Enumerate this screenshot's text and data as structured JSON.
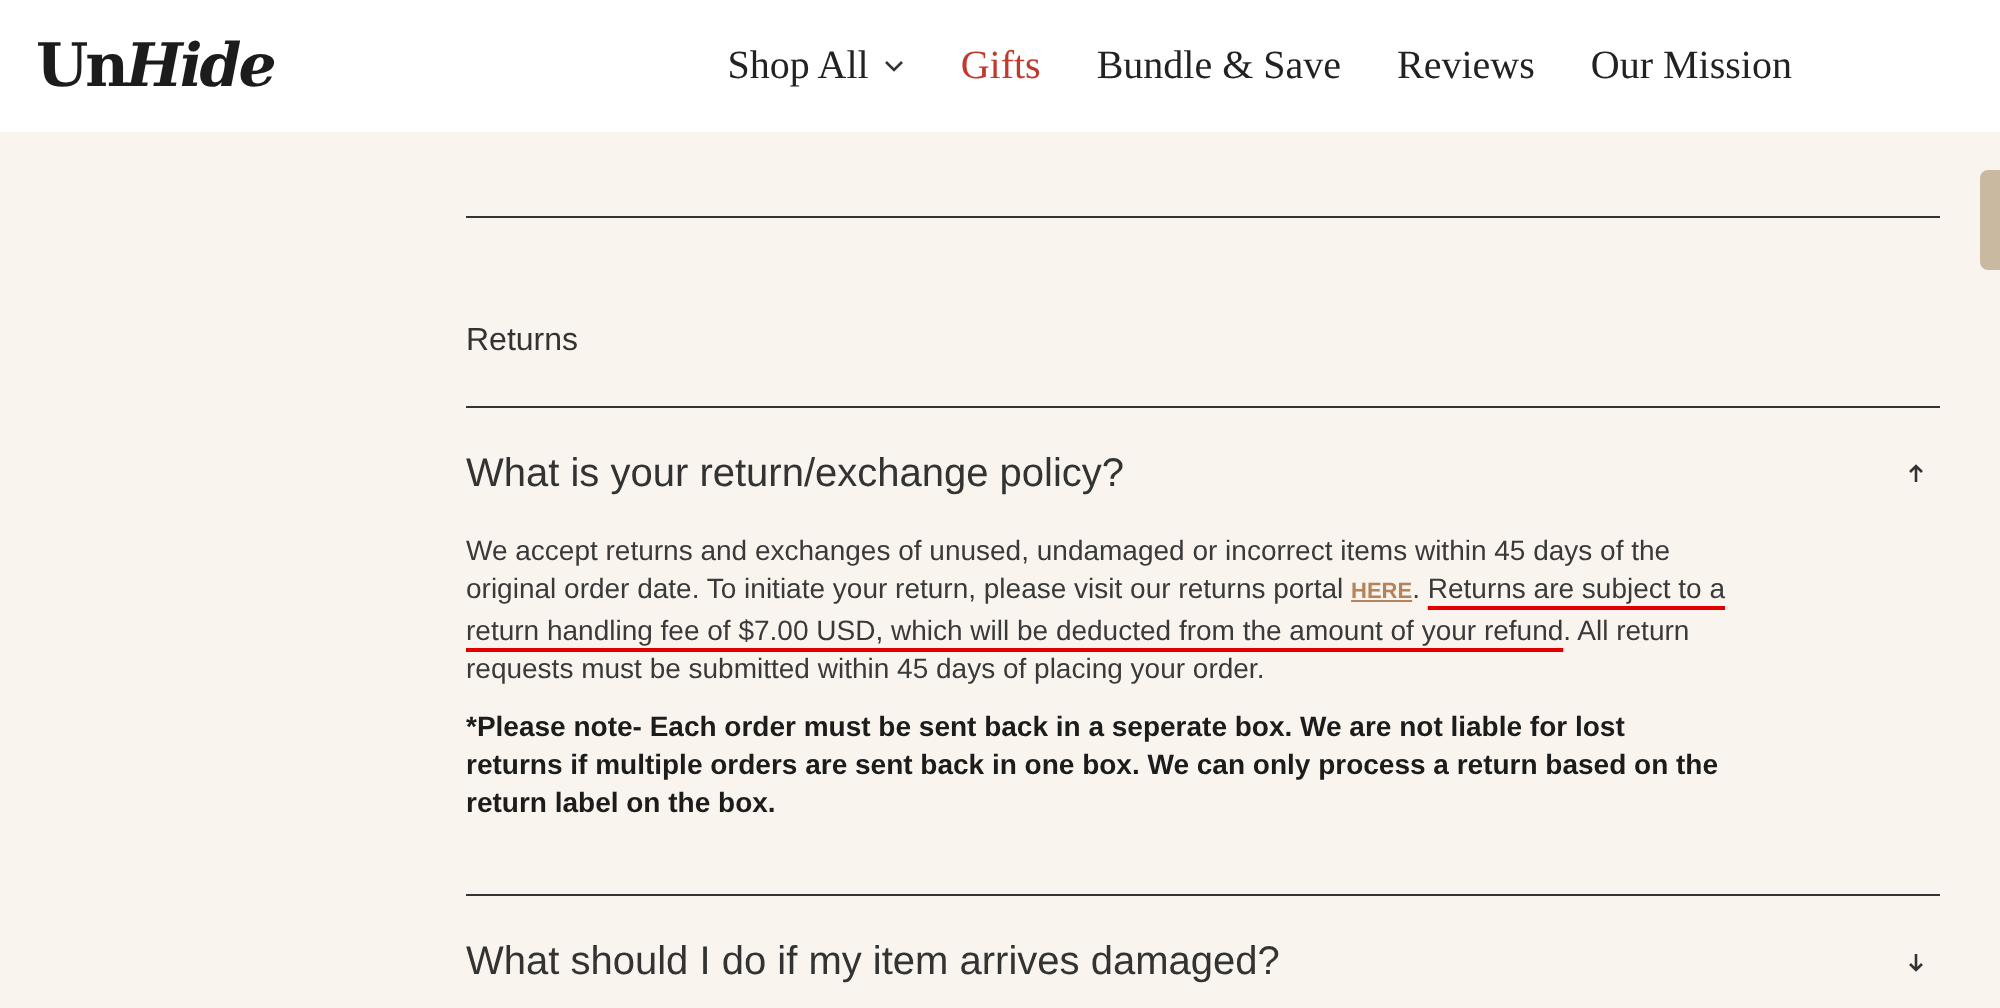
{
  "logo": {
    "upright_part": "Un",
    "italic_part": "Hide"
  },
  "nav": [
    {
      "label": "Shop All",
      "selected": false,
      "dropdown": true
    },
    {
      "label": "Gifts",
      "selected": true,
      "dropdown": false
    },
    {
      "label": "Bundle & Save",
      "selected": false,
      "dropdown": false
    },
    {
      "label": "Reviews",
      "selected": false,
      "dropdown": false
    },
    {
      "label": "Our Mission",
      "selected": false,
      "dropdown": false
    }
  ],
  "section_title": "Returns",
  "faq": [
    {
      "question": "What is your return/exchange policy?",
      "expanded": true,
      "answer": [
        {
          "kind": "text",
          "text": "We accept returns and exchanges of unused, undamaged or incorrect items within 45 days of the original order date. To initiate your return, please visit our returns portal "
        },
        {
          "kind": "link",
          "text": "HERE"
        },
        {
          "kind": "text",
          "text": ". "
        },
        {
          "kind": "marked",
          "text": "Returns are subject to a return handling fee of $7.00 USD, which will be deducted from the amount of your refund"
        },
        {
          "kind": "text",
          "text": ". All return requests must be submitted within 45 days of placing your order."
        }
      ],
      "note": "*Please note- Each order must be sent back in a seperate box. We are not liable for lost returns if multiple orders are sent back in one box. We can only process a return based on the return label on the box."
    },
    {
      "question": "What should I do if my item arrives damaged?",
      "expanded": false
    }
  ]
}
